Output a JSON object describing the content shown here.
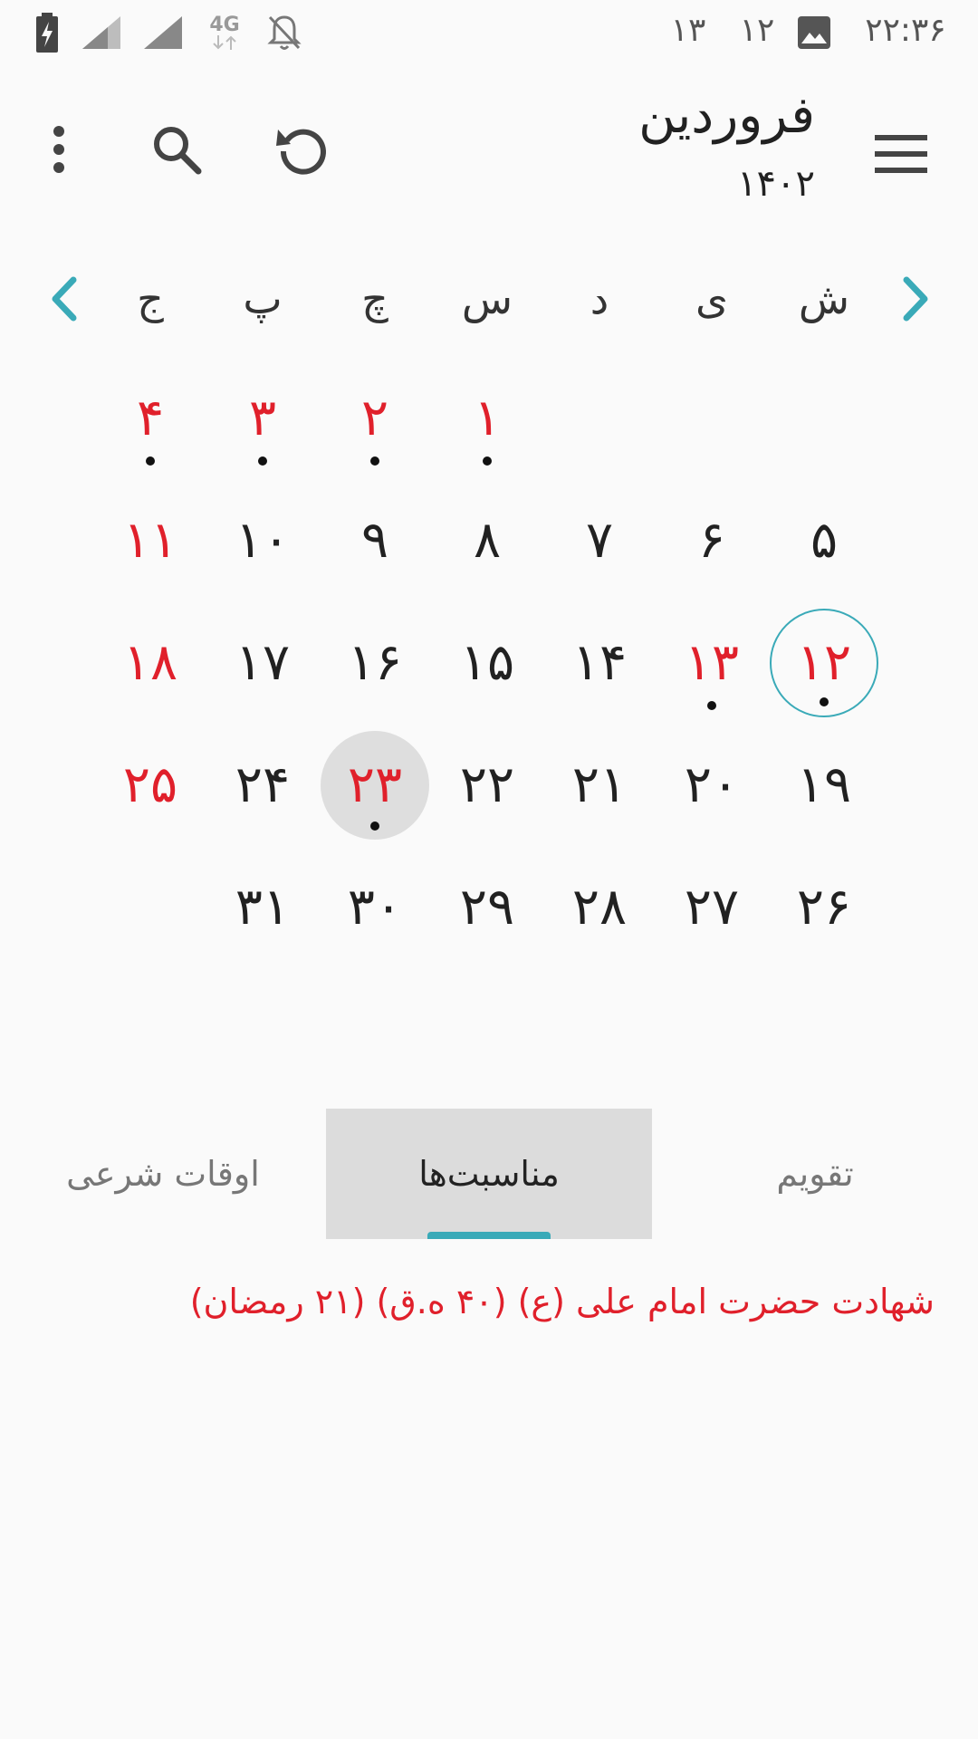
{
  "status_bar": {
    "time": "۲۲:۳۶",
    "notif_a": "۱۲",
    "notif_b": "۱۳",
    "network": "4G",
    "icons": [
      "battery-charging-icon",
      "signal-icon",
      "signal-icon",
      "network-4g-icon",
      "notifications-off-icon",
      "image-icon"
    ]
  },
  "app_bar": {
    "month": "فروردین",
    "year": "۱۴۰۲",
    "icons": [
      "menu-icon",
      "refresh-icon",
      "search-icon",
      "more-vert-icon"
    ]
  },
  "calendar": {
    "weekdays": [
      "ش",
      "ی",
      "د",
      "س",
      "چ",
      "پ",
      "ج"
    ],
    "weeks": [
      [
        null,
        null,
        null,
        {
          "d": "۱",
          "holiday": true,
          "event": true
        },
        {
          "d": "۲",
          "holiday": true,
          "event": true
        },
        {
          "d": "۳",
          "holiday": true,
          "event": true
        },
        {
          "d": "۴",
          "holiday": true,
          "event": true
        }
      ],
      [
        {
          "d": "۵"
        },
        {
          "d": "۶"
        },
        {
          "d": "۷"
        },
        {
          "d": "۸"
        },
        {
          "d": "۹"
        },
        {
          "d": "۱۰"
        },
        {
          "d": "۱۱",
          "holiday": true
        }
      ],
      [
        {
          "d": "۱۲",
          "holiday": true,
          "event": true,
          "today": true
        },
        {
          "d": "۱۳",
          "holiday": true,
          "event": true
        },
        {
          "d": "۱۴"
        },
        {
          "d": "۱۵"
        },
        {
          "d": "۱۶"
        },
        {
          "d": "۱۷"
        },
        {
          "d": "۱۸",
          "holiday": true
        }
      ],
      [
        {
          "d": "۱۹"
        },
        {
          "d": "۲۰"
        },
        {
          "d": "۲۱"
        },
        {
          "d": "۲۲"
        },
        {
          "d": "۲۳",
          "holiday": true,
          "event": true,
          "selected": true
        },
        {
          "d": "۲۴"
        },
        {
          "d": "۲۵",
          "holiday": true
        }
      ],
      [
        {
          "d": "۲۶"
        },
        {
          "d": "۲۷"
        },
        {
          "d": "۲۸"
        },
        {
          "d": "۲۹"
        },
        {
          "d": "۳۰"
        },
        {
          "d": "۳۱"
        },
        null
      ]
    ]
  },
  "tabs": {
    "items": [
      "تقویم",
      "مناسبت‌ها",
      "اوقات شرعی"
    ],
    "active_index": 1
  },
  "event_text": "شهادت حضرت امام علی (ع) (۴۰ ه.ق) (۲۱ رمضان)",
  "colors": {
    "accent": "#3aaab8",
    "holiday": "#e0202b",
    "background": "#fafafa"
  }
}
